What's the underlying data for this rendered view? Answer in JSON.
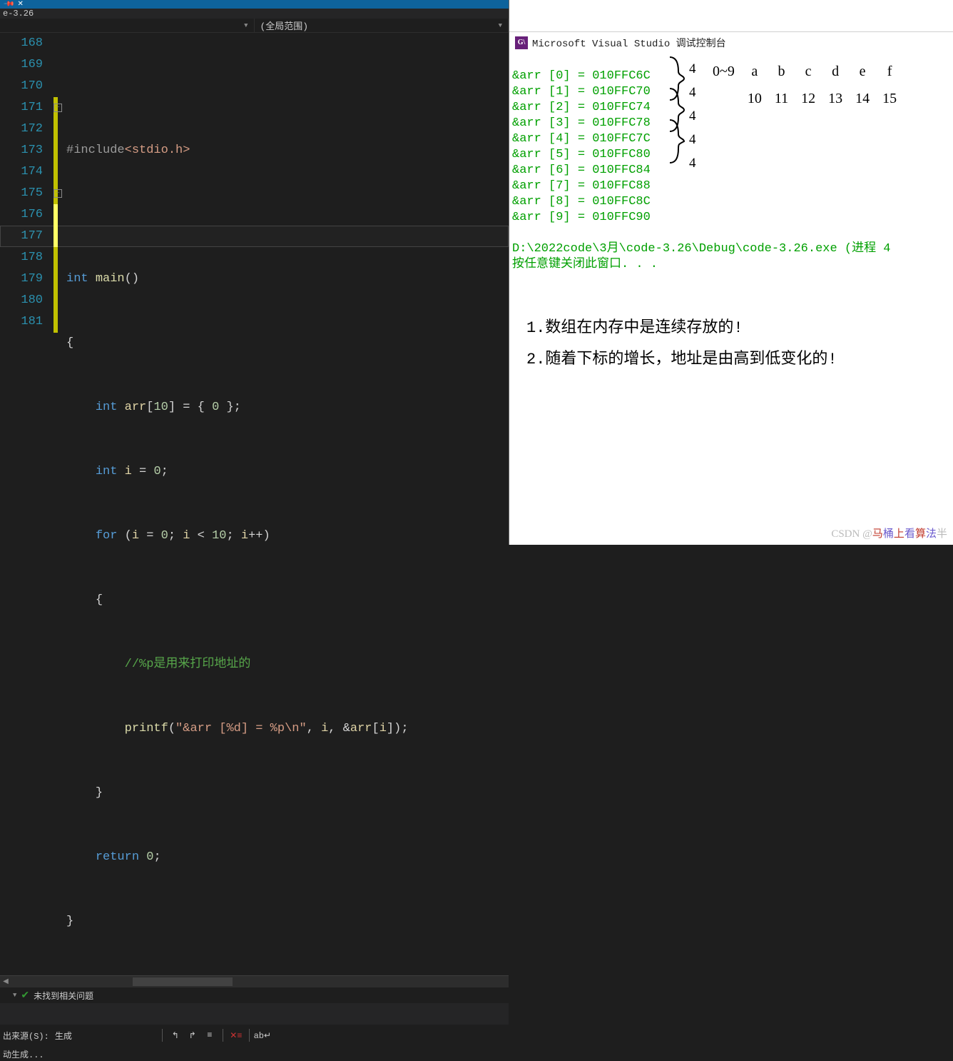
{
  "tabbar": {
    "file_label": "e-3.26"
  },
  "scopebar": {
    "left": "",
    "right": "(全局范围)"
  },
  "gutter": [
    "168",
    "169",
    "170",
    "171",
    "172",
    "173",
    "174",
    "175",
    "176",
    "177",
    "178",
    "179",
    "180",
    "181"
  ],
  "code": {
    "l168": "",
    "l169_pre": "#include",
    "l169_hdr": "<stdio.h>",
    "l170": "",
    "l171": "int main()",
    "l172": "{",
    "l173_a": "int ",
    "l173_b": "arr",
    "l173_c": "[10] = { 0 };",
    "l174_a": "int ",
    "l174_b": "i",
    "l174_c": " = 0;",
    "l175_a": "for ",
    "l175_b": "(i = 0; i < 10; i++)",
    "l176": "{",
    "l177": "//%p是用来打印地址的",
    "l178_a": "printf",
    "l178_b": "(",
    "l178_str": "\"&arr [%d] = %p\\n\"",
    "l178_c": ", i, &arr[i]);",
    "l179": "}",
    "l180_a": "return ",
    "l180_b": "0",
    "l180_c": ";",
    "l181": "}"
  },
  "errorbar": {
    "msg": "未找到相关问题"
  },
  "filterbar": {
    "label": "出来源(S):",
    "value": "生成"
  },
  "statusline": "动生成...",
  "console": {
    "title": "Microsoft Visual Studio 调试控制台",
    "lines": [
      "&arr [0] = 010FFC6C",
      "&arr [1] = 010FFC70",
      "&arr [2] = 010FFC74",
      "&arr [3] = 010FFC78",
      "&arr [4] = 010FFC7C",
      "&arr [5] = 010FFC80",
      "&arr [6] = 010FFC84",
      "&arr [7] = 010FFC88",
      "&arr [8] = 010FFC8C",
      "&arr [9] = 010FFC90",
      "",
      "D:\\2022code\\3月\\code-3.26\\Debug\\code-3.26.exe (进程 4",
      "按任意键关闭此窗口. . ."
    ]
  },
  "hex_table": {
    "header": [
      "0~9",
      "a",
      "b",
      "c",
      "d",
      "e",
      "f"
    ],
    "row": [
      "",
      "10",
      "11",
      "12",
      "13",
      "14",
      "15"
    ]
  },
  "brace_vals": [
    "4",
    "4",
    "4",
    "4",
    "4"
  ],
  "notes": {
    "n1": "1.数组在内存中是连续存放的!",
    "n2": "2.随着下标的增长，地址是由高到低变化的!"
  },
  "watermark": {
    "prefix": "CSDN @",
    "text": "马桶上看算法半"
  }
}
